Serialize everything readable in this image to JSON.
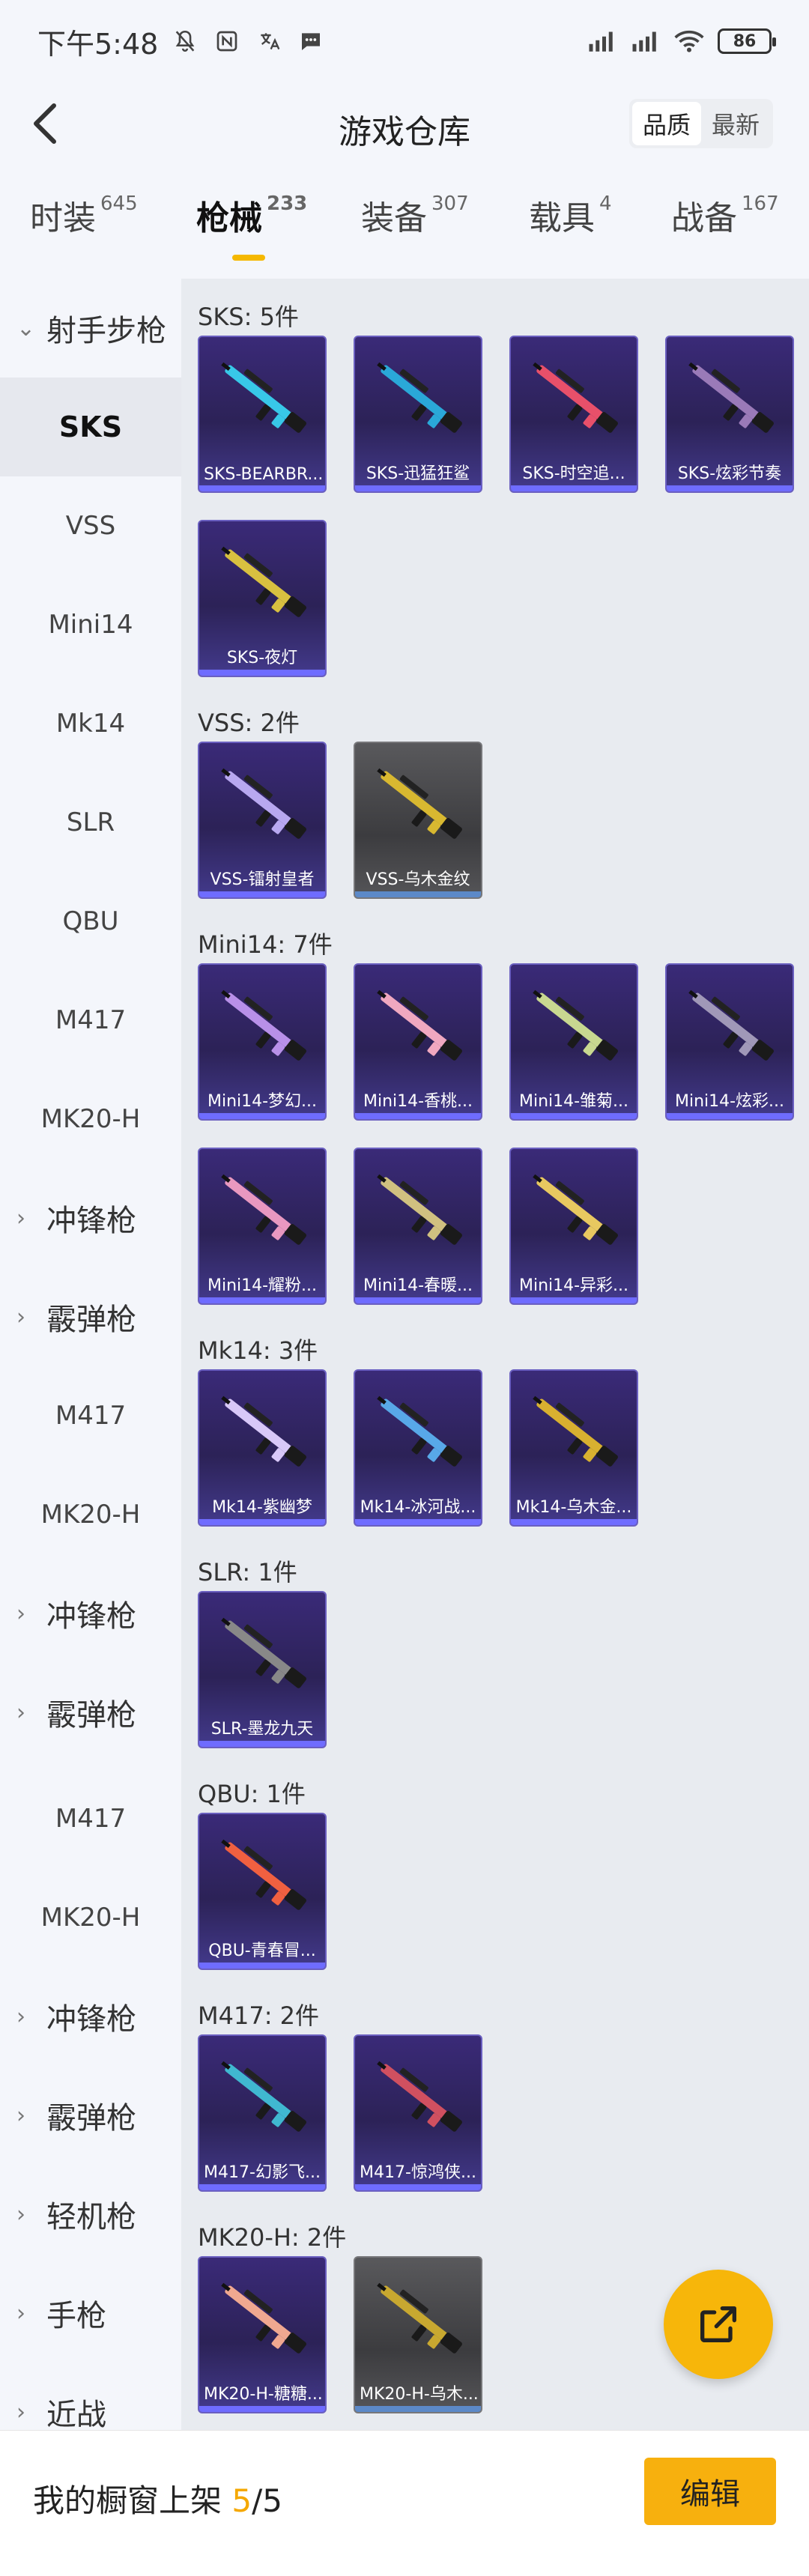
{
  "status_bar": {
    "time": "下午5:48",
    "battery": "86"
  },
  "header": {
    "title": "游戏仓库",
    "sort_quality": "品质",
    "sort_latest": "最新"
  },
  "tabs": [
    {
      "label": "时装",
      "count": "645"
    },
    {
      "label": "枪械",
      "count": "233"
    },
    {
      "label": "装备",
      "count": "307"
    },
    {
      "label": "载具",
      "count": "4"
    },
    {
      "label": "战备",
      "count": "167"
    }
  ],
  "sidebar": [
    {
      "label": "射手步枪",
      "group": true,
      "arrow": "⌄"
    },
    {
      "label": "SKS"
    },
    {
      "label": "VSS"
    },
    {
      "label": "Mini14"
    },
    {
      "label": "Mk14"
    },
    {
      "label": "SLR"
    },
    {
      "label": "QBU"
    },
    {
      "label": "M417"
    },
    {
      "label": "MK20-H"
    },
    {
      "label": "冲锋枪",
      "group": true,
      "arrow": "›"
    },
    {
      "label": "霰弹枪",
      "group": true,
      "arrow": "›"
    },
    {
      "label": "M417"
    },
    {
      "label": "MK20-H"
    },
    {
      "label": "冲锋枪",
      "group": true,
      "arrow": "›"
    },
    {
      "label": "霰弹枪",
      "group": true,
      "arrow": "›"
    },
    {
      "label": "M417"
    },
    {
      "label": "MK20-H"
    },
    {
      "label": "冲锋枪",
      "group": true,
      "arrow": "›"
    },
    {
      "label": "霰弹枪",
      "group": true,
      "arrow": "›"
    },
    {
      "label": "轻机枪",
      "group": true,
      "arrow": "›"
    },
    {
      "label": "手枪",
      "group": true,
      "arrow": "›"
    },
    {
      "label": "近战",
      "group": true,
      "arrow": "›"
    }
  ],
  "sections": [
    {
      "title": "SKS: 5件",
      "items": [
        {
          "name": "SKS-BEARBR...",
          "color": "#38c8e8"
        },
        {
          "name": "SKS-迅猛狂鲨",
          "color": "#2aa8d8"
        },
        {
          "name": "SKS-时空追...",
          "color": "#e8506a"
        },
        {
          "name": "SKS-炫彩节奏",
          "color": "#9a7ab8"
        },
        {
          "name": "SKS-夜灯",
          "color": "#d8c040"
        }
      ]
    },
    {
      "title": "VSS: 2件",
      "items": [
        {
          "name": "VSS-镭射皇者",
          "color": "#b8a8f0"
        },
        {
          "name": "VSS-乌木金纹",
          "color": "#d8b830",
          "grey": true
        }
      ]
    },
    {
      "title": "Mini14: 7件",
      "items": [
        {
          "name": "Mini14-梦幻...",
          "color": "#b890e8"
        },
        {
          "name": "Mini14-香桃...",
          "color": "#f0a8c0"
        },
        {
          "name": "Mini14-雏菊...",
          "color": "#c8d890"
        },
        {
          "name": "Mini14-炫彩...",
          "color": "#a098b8"
        },
        {
          "name": "Mini14-耀粉...",
          "color": "#e898c0"
        },
        {
          "name": "Mini14-春暖...",
          "color": "#d0c080"
        },
        {
          "name": "Mini14-异彩...",
          "color": "#e8c860"
        }
      ]
    },
    {
      "title": "Mk14: 3件",
      "items": [
        {
          "name": "Mk14-紫幽梦",
          "color": "#d8c8f8"
        },
        {
          "name": "Mk14-冰河战...",
          "color": "#58a8e8"
        },
        {
          "name": "Mk14-乌木金...",
          "color": "#d8b030"
        }
      ]
    },
    {
      "title": "SLR: 1件",
      "items": [
        {
          "name": "SLR-墨龙九天",
          "color": "#888888"
        }
      ]
    },
    {
      "title": "QBU: 1件",
      "items": [
        {
          "name": "QBU-青春冒...",
          "color": "#f06040"
        }
      ]
    },
    {
      "title": "M417: 2件",
      "items": [
        {
          "name": "M417-幻影飞...",
          "color": "#40b8d0"
        },
        {
          "name": "M417-惊鸿侠...",
          "color": "#d05060"
        }
      ]
    },
    {
      "title": "MK20-H: 2件",
      "items": [
        {
          "name": "MK20-H-糖糖...",
          "color": "#f0a890"
        },
        {
          "name": "MK20-H-乌木...",
          "color": "#c8a830",
          "grey": true
        }
      ]
    }
  ],
  "bottom": {
    "label": "我的橱窗上架",
    "current": "5",
    "total": "/5",
    "edit": "编辑"
  }
}
